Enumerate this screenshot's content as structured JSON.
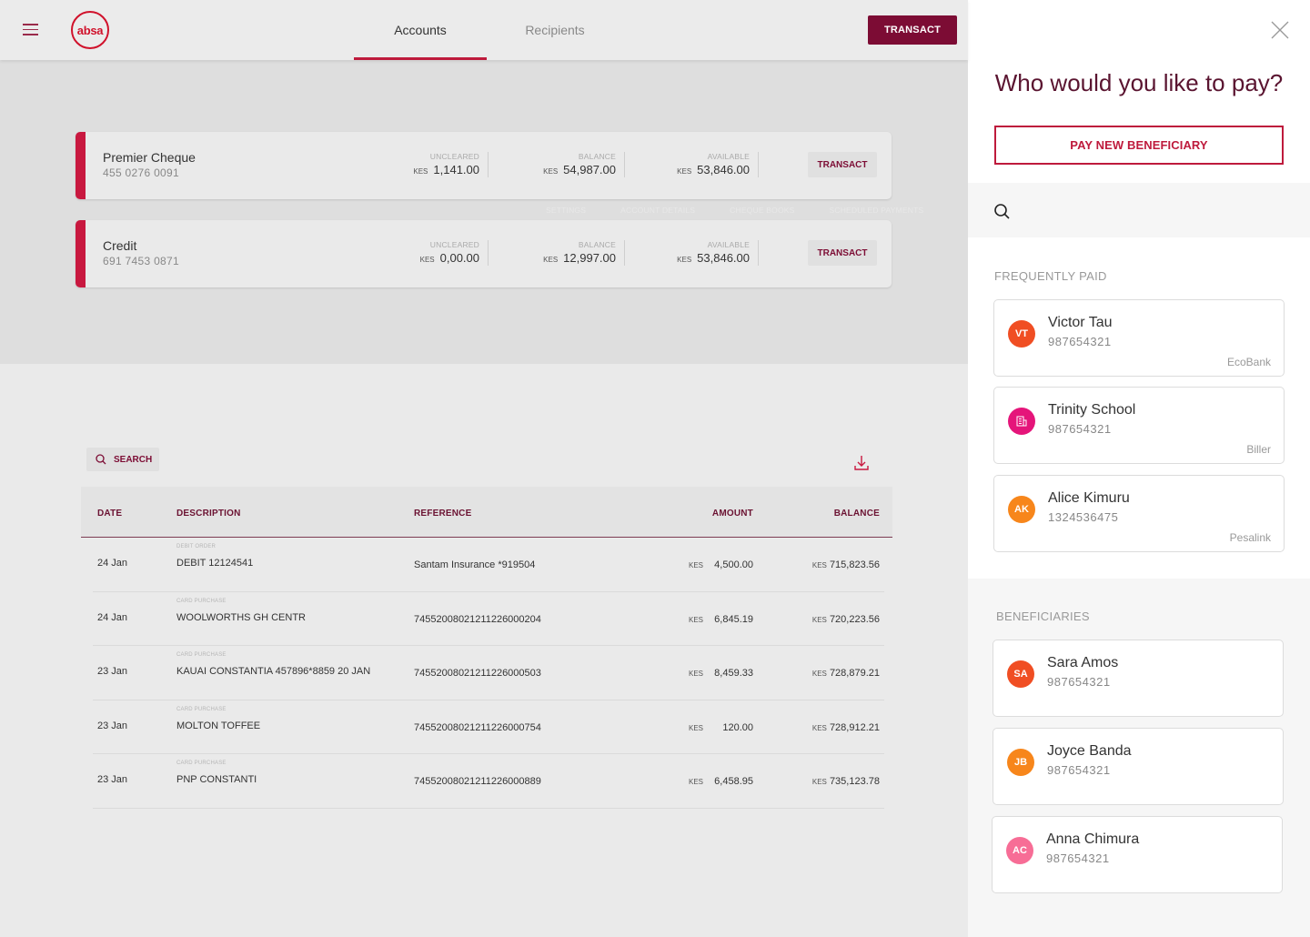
{
  "header": {
    "logo_text": "absa",
    "tabs": [
      {
        "label": "Accounts",
        "active": true
      },
      {
        "label": "Recipients",
        "active": false
      }
    ],
    "transact_label": "TRANSACT"
  },
  "accounts": [
    {
      "name": "Premier Cheque",
      "number": "455 0276 0091",
      "uncleared_label": "UNCLEARED",
      "uncleared_currency": "KES",
      "uncleared": "1,141.00",
      "balance_label": "BALANCE",
      "balance_currency": "KES",
      "balance": "54,987.00",
      "available_label": "AVAILABLE",
      "available_currency": "KES",
      "available": "53,846.00",
      "transact_label": "TRANSACT"
    },
    {
      "name": "Credit",
      "number": "691 7453 0871",
      "uncleared_label": "UNCLEARED",
      "uncleared_currency": "KES",
      "uncleared": "0,00.00",
      "balance_label": "BALANCE",
      "balance_currency": "KES",
      "balance": "12,997.00",
      "available_label": "AVAILABLE",
      "available_currency": "KES",
      "available": "53,846.00",
      "transact_label": "TRANSACT"
    }
  ],
  "account_links": [
    "SETTINGS",
    "ACCOUNT DETAILS",
    "CHEQUE BOOKS",
    "SCHEDULED PAYMENTS"
  ],
  "transactions": {
    "search_label": "SEARCH",
    "columns": [
      "DATE",
      "DESCRIPTION",
      "REFERENCE",
      "AMOUNT",
      "BALANCE"
    ],
    "rows": [
      {
        "date": "24 Jan",
        "category": "DEBIT ORDER",
        "description": "DEBIT 12124541",
        "reference": "Santam Insurance *919504",
        "currency": "KES",
        "amount": "4,500.00",
        "balance_currency": "KES",
        "balance": "715,823.56"
      },
      {
        "date": "24 Jan",
        "category": "CARD PURCHASE",
        "description": "WOOLWORTHS GH CENTR",
        "reference": "74552008021211226000204",
        "currency": "KES",
        "amount": "6,845.19",
        "balance_currency": "KES",
        "balance": "720,223.56"
      },
      {
        "date": "23 Jan",
        "category": "CARD PURCHASE",
        "description": "KAUAI CONSTANTIA 457896*8859 20 JAN",
        "reference": "74552008021211226000503",
        "currency": "KES",
        "amount": "8,459.33",
        "balance_currency": "KES",
        "balance": "728,879.21"
      },
      {
        "date": "23 Jan",
        "category": "CARD PURCHASE",
        "description": "MOLTON TOFFEE",
        "reference": "74552008021211226000754",
        "currency": "KES",
        "amount": "120.00",
        "balance_currency": "KES",
        "balance": "728,912.21"
      },
      {
        "date": "23 Jan",
        "category": "CARD PURCHASE",
        "description": "PNP CONSTANTI",
        "reference": "74552008021211226000889",
        "currency": "KES",
        "amount": "6,458.95",
        "balance_currency": "KES",
        "balance": "735,123.78"
      }
    ]
  },
  "panel": {
    "title": "Who would you like to pay?",
    "pay_new_label": "PAY NEW BENEFICIARY",
    "search_placeholder": "",
    "frequent_label": "FREQUENTLY PAID",
    "frequent": [
      {
        "initials": "VT",
        "name": "Victor Tau",
        "account": "987654321",
        "bank": "EcoBank",
        "color": "#f04e23",
        "icon": "initials"
      },
      {
        "initials": "",
        "name": "Trinity School",
        "account": "987654321",
        "bank": "Biller",
        "color": "#e5157a",
        "icon": "building-icon"
      },
      {
        "initials": "AK",
        "name": "Alice Kimuru",
        "account": "1324536475",
        "bank": "Pesalink",
        "color": "#f7861b",
        "icon": "initials"
      }
    ],
    "beneficiaries_label": "BENEFICIARIES",
    "beneficiaries": [
      {
        "initials": "SA",
        "name": "Sara Amos",
        "account": "987654321",
        "color": "#f04e23"
      },
      {
        "initials": "JB",
        "name": "Joyce Banda",
        "account": "987654321",
        "color": "#f7861b"
      },
      {
        "initials": "AC",
        "name": "Anna Chimura",
        "account": "987654321",
        "color": "#f76d96"
      }
    ]
  },
  "colors": {
    "brand_red": "#be1a3c",
    "brand_maroon": "#7c0c34",
    "logo_red": "#d0112b"
  }
}
